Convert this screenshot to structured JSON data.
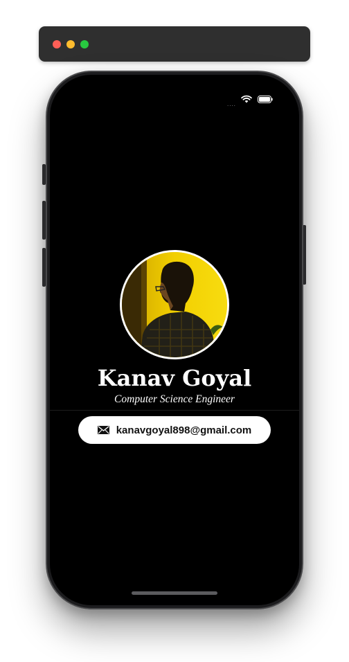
{
  "profile": {
    "name": "Kanav Goyal",
    "title": "Computer Science Engineer",
    "email": "kanavgoyal898@gmail.com",
    "email_icon": "mail-icon"
  },
  "status_bar": {
    "signal": "....",
    "wifi_icon": "wifi-icon",
    "battery_icon": "battery-icon"
  },
  "window": {
    "controls": [
      "close",
      "minimize",
      "zoom"
    ]
  },
  "colors": {
    "background": "#000000",
    "avatar_bg": "#e6c400",
    "button_bg": "#ffffff",
    "text": "#ffffff"
  }
}
